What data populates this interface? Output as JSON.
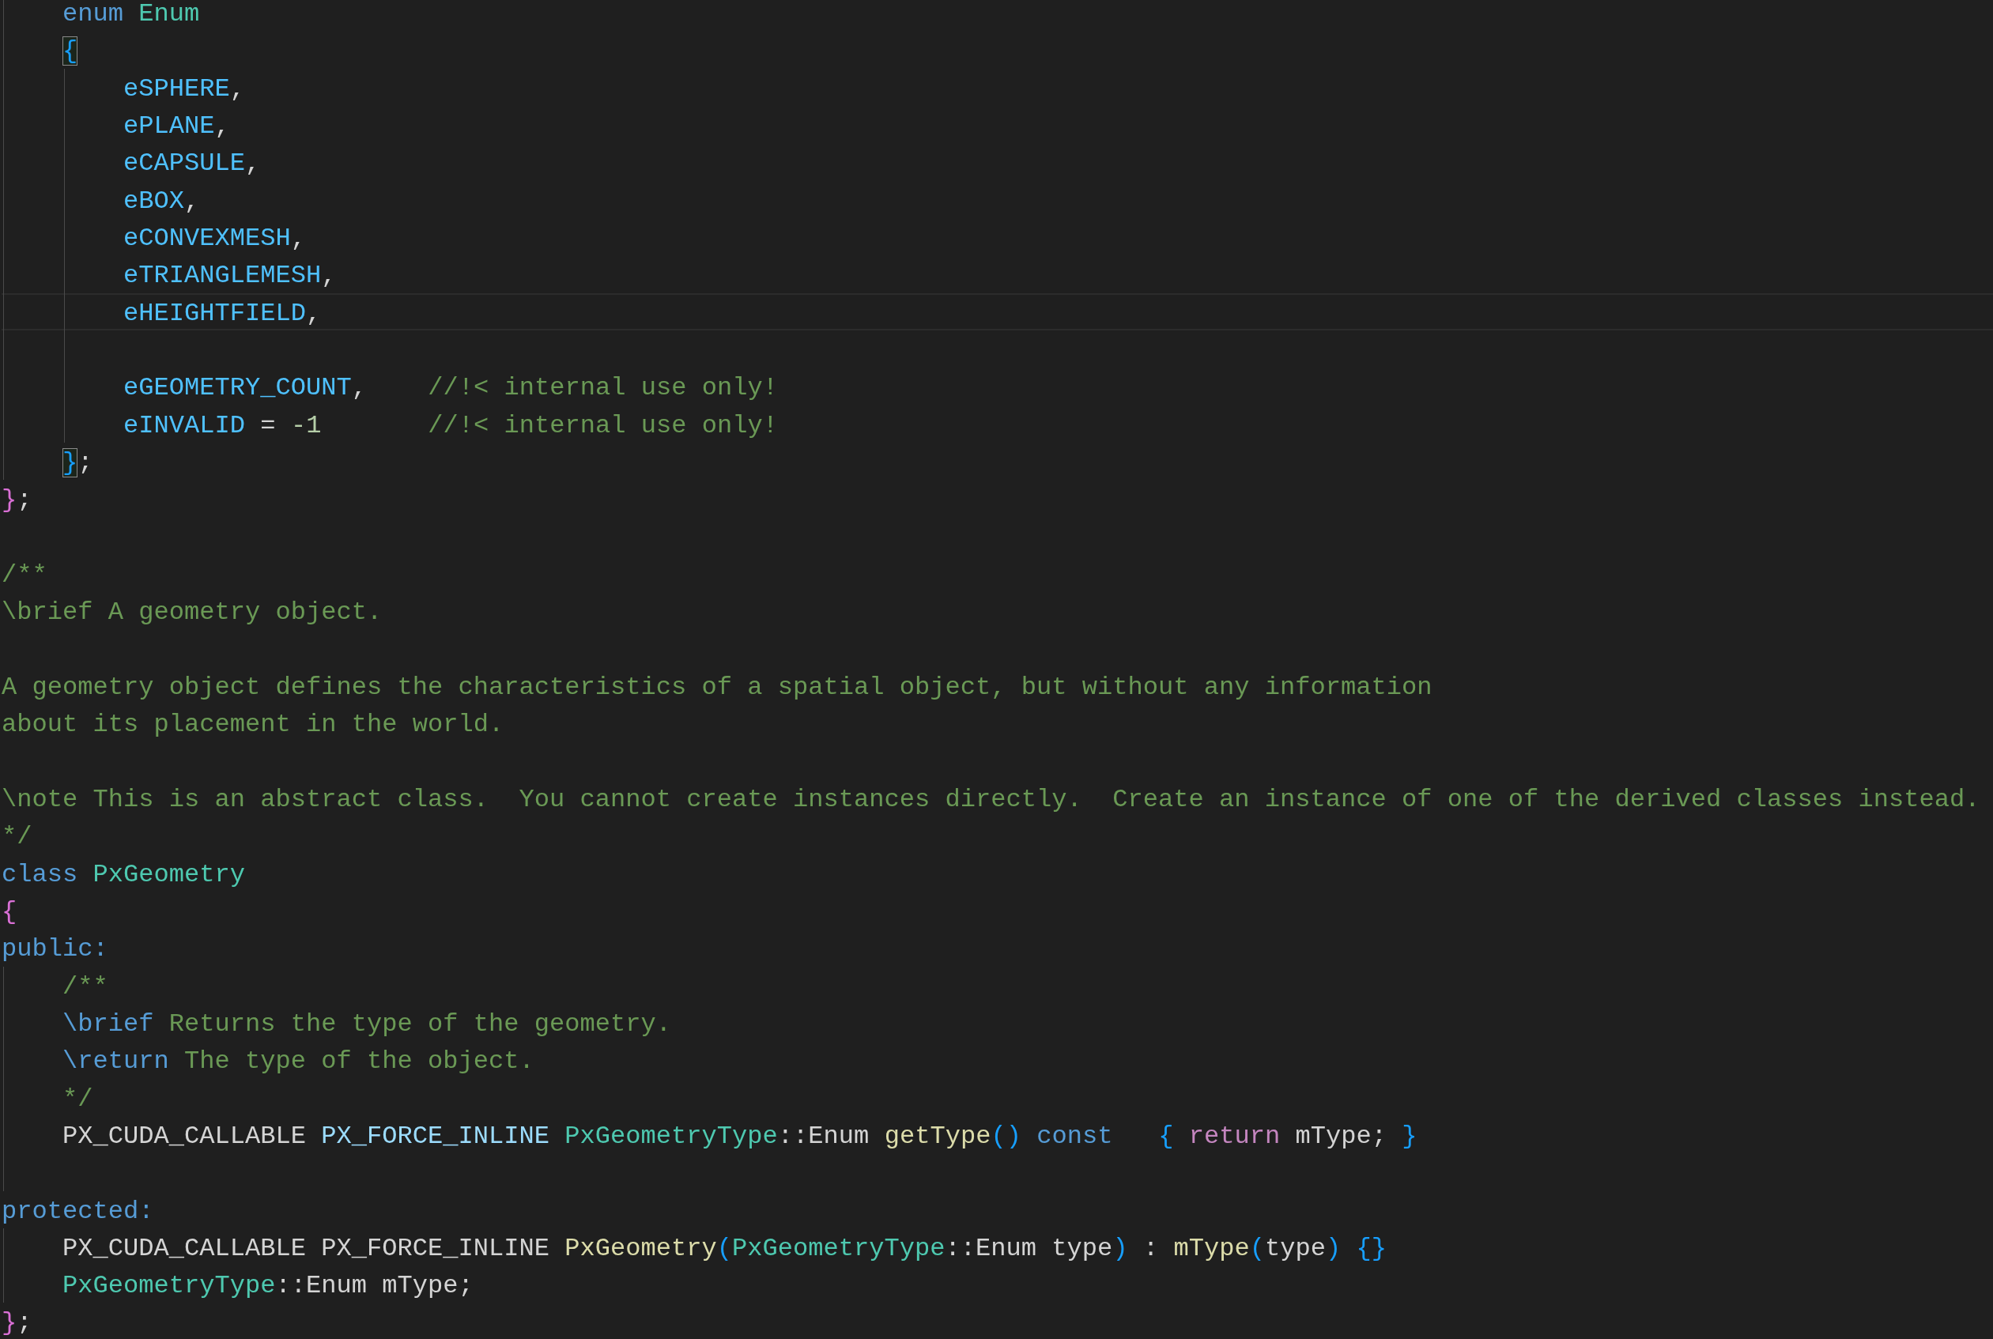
{
  "editor": {
    "lines": [
      {
        "current": false,
        "tokens": [
          {
            "kind": "keyword",
            "text": "    enum"
          },
          {
            "kind": "type",
            "text": " Enum"
          }
        ]
      },
      {
        "current": false,
        "tokens": [
          {
            "kind": "bracket",
            "text": "    {",
            "color": "#179fff",
            "matched": true
          }
        ]
      },
      {
        "current": false,
        "tokens": [
          {
            "kind": "member",
            "text": "        eSPHERE"
          },
          {
            "kind": "plain",
            "text": ","
          }
        ]
      },
      {
        "current": false,
        "tokens": [
          {
            "kind": "member",
            "text": "        ePLANE"
          },
          {
            "kind": "plain",
            "text": ","
          }
        ]
      },
      {
        "current": false,
        "tokens": [
          {
            "kind": "member",
            "text": "        eCAPSULE"
          },
          {
            "kind": "plain",
            "text": ","
          }
        ]
      },
      {
        "current": false,
        "tokens": [
          {
            "kind": "member",
            "text": "        eBOX"
          },
          {
            "kind": "plain",
            "text": ","
          }
        ]
      },
      {
        "current": false,
        "tokens": [
          {
            "kind": "member",
            "text": "        eCONVEXMESH"
          },
          {
            "kind": "plain",
            "text": ","
          }
        ]
      },
      {
        "current": false,
        "tokens": [
          {
            "kind": "member",
            "text": "        eTRIANGLEMESH"
          },
          {
            "kind": "plain",
            "text": ","
          }
        ]
      },
      {
        "current": true,
        "tokens": [
          {
            "kind": "member",
            "text": "        eHEIGHTFIELD"
          },
          {
            "kind": "plain",
            "text": ","
          }
        ]
      },
      {
        "current": false
      },
      {
        "current": false,
        "tokens": [
          {
            "kind": "member",
            "text": "        eGEOMETRY_COUNT"
          },
          {
            "kind": "plain",
            "text": ","
          },
          {
            "kind": "comment",
            "text": "    //!< internal use only!"
          }
        ]
      },
      {
        "current": false,
        "tokens": [
          {
            "kind": "member",
            "text": "        eINVALID"
          },
          {
            "kind": "plain",
            "text": " ="
          },
          {
            "kind": "number",
            "text": " -1"
          },
          {
            "kind": "comment",
            "text": "       //!< internal use only!"
          }
        ]
      },
      {
        "current": false,
        "tokens": [
          {
            "kind": "bracket",
            "text": "    }",
            "color": "#179fff",
            "matched": true
          },
          {
            "kind": "plain",
            "text": ";"
          }
        ]
      },
      {
        "current": false,
        "tokens": [
          {
            "kind": "bracket",
            "text": "}",
            "color": "#da70d6",
            "matched": false
          },
          {
            "kind": "plain",
            "text": ";"
          }
        ]
      },
      {
        "current": false
      },
      {
        "current": false,
        "tokens": [
          {
            "kind": "comment",
            "text": "/**"
          }
        ]
      },
      {
        "current": false,
        "tokens": [
          {
            "kind": "comment",
            "text": "\\brief A geometry object."
          }
        ]
      },
      {
        "current": false
      },
      {
        "current": false,
        "tokens": [
          {
            "kind": "comment",
            "text": "A geometry object defines the characteristics of a spatial object, but without any information"
          }
        ]
      },
      {
        "current": false,
        "tokens": [
          {
            "kind": "comment",
            "text": "about its placement in the world."
          }
        ]
      },
      {
        "current": false
      },
      {
        "current": false,
        "tokens": [
          {
            "kind": "comment",
            "text": "\\note This is an abstract class.  You cannot create instances directly.  Create an instance of one of the derived classes instead."
          }
        ]
      },
      {
        "current": false,
        "tokens": [
          {
            "kind": "comment",
            "text": "*/"
          }
        ]
      },
      {
        "current": false,
        "tokens": [
          {
            "kind": "keyword",
            "text": "class"
          },
          {
            "kind": "type",
            "text": " PxGeometry"
          }
        ]
      },
      {
        "current": false,
        "tokens": [
          {
            "kind": "bracket",
            "text": "{",
            "color": "#da70d6",
            "matched": false
          }
        ]
      },
      {
        "current": false,
        "tokens": [
          {
            "kind": "keyword",
            "text": "public:"
          }
        ]
      },
      {
        "current": false,
        "tokens": [
          {
            "kind": "comment",
            "text": "    /**"
          }
        ]
      },
      {
        "current": false,
        "tokens": [
          {
            "kind": "doctag",
            "text": "    \\brief"
          },
          {
            "kind": "comment",
            "text": " Returns the type of the geometry."
          }
        ]
      },
      {
        "current": false,
        "tokens": [
          {
            "kind": "doctag",
            "text": "    \\return"
          },
          {
            "kind": "comment",
            "text": " The type of the object."
          }
        ]
      },
      {
        "current": false,
        "tokens": [
          {
            "kind": "comment",
            "text": "    */"
          }
        ]
      },
      {
        "current": false,
        "tokens": [
          {
            "kind": "plain",
            "text": "    PX_CUDA_CALLABLE"
          },
          {
            "kind": "macro",
            "text": " PX_FORCE_INLINE"
          },
          {
            "kind": "type",
            "text": " PxGeometryType"
          },
          {
            "kind": "plain",
            "text": "::Enum"
          },
          {
            "kind": "function",
            "text": " getType"
          },
          {
            "kind": "bracket",
            "text": "(",
            "color": "#179fff",
            "matched": false
          },
          {
            "kind": "bracket",
            "text": ")",
            "color": "#179fff",
            "matched": false
          },
          {
            "kind": "keyword",
            "text": " const"
          },
          {
            "kind": "bracket",
            "text": "   {",
            "color": "#179fff",
            "matched": false
          },
          {
            "kind": "control",
            "text": " return"
          },
          {
            "kind": "plain",
            "text": " mType;"
          },
          {
            "kind": "bracket",
            "text": " }",
            "color": "#179fff",
            "matched": false
          }
        ]
      },
      {
        "current": false
      },
      {
        "current": false,
        "tokens": [
          {
            "kind": "keyword",
            "text": "protected:"
          }
        ]
      },
      {
        "current": false,
        "tokens": [
          {
            "kind": "plain",
            "text": "    PX_CUDA_CALLABLE PX_FORCE_INLINE"
          },
          {
            "kind": "function",
            "text": " PxGeometry"
          },
          {
            "kind": "bracket",
            "text": "(",
            "color": "#179fff",
            "matched": false
          },
          {
            "kind": "type",
            "text": "PxGeometryType"
          },
          {
            "kind": "plain",
            "text": "::Enum type"
          },
          {
            "kind": "bracket",
            "text": ")",
            "color": "#179fff",
            "matched": false
          },
          {
            "kind": "plain",
            "text": " :"
          },
          {
            "kind": "function",
            "text": " mType"
          },
          {
            "kind": "bracket",
            "text": "(",
            "color": "#179fff",
            "matched": false
          },
          {
            "kind": "plain",
            "text": "type"
          },
          {
            "kind": "bracket",
            "text": ")",
            "color": "#179fff",
            "matched": false
          },
          {
            "kind": "bracket",
            "text": " {",
            "color": "#179fff",
            "matched": false
          },
          {
            "kind": "bracket",
            "text": "}",
            "color": "#179fff",
            "matched": false
          }
        ]
      },
      {
        "current": false,
        "tokens": [
          {
            "kind": "type",
            "text": "    PxGeometryType"
          },
          {
            "kind": "plain",
            "text": "::Enum mType;"
          }
        ]
      },
      {
        "current": false,
        "tokens": [
          {
            "kind": "bracket",
            "text": "}",
            "color": "#da70d6",
            "matched": false
          },
          {
            "kind": "plain",
            "text": ";"
          }
        ]
      }
    ]
  }
}
